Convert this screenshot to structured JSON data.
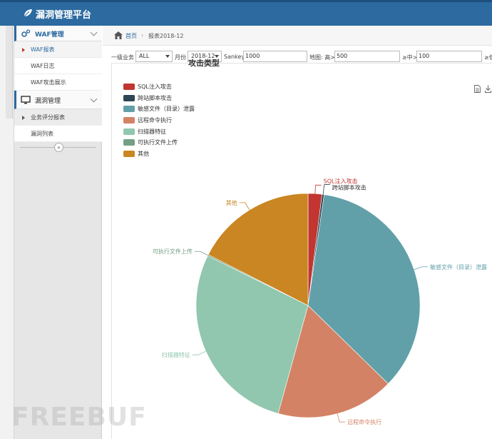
{
  "app": {
    "title": "漏洞管理平台"
  },
  "sidebar": {
    "groups": [
      {
        "label": "WAF管理",
        "icon": "gears-icon",
        "items": [
          {
            "label": "WAF报表"
          },
          {
            "label": "WAF日志"
          },
          {
            "label": "WAF攻击展示"
          }
        ]
      },
      {
        "label": "漏洞管理",
        "icon": "monitor-icon",
        "items": [
          {
            "label": "业务评分报表"
          },
          {
            "label": "漏洞列表"
          }
        ]
      }
    ],
    "collapse_glyph": "«"
  },
  "breadcrumb": {
    "home": "首页",
    "separator": "›",
    "current": "报表2018-12"
  },
  "filters": {
    "business_label": "一级业务",
    "business_value": "ALL",
    "month_label": "月份",
    "month_value": "2018-12",
    "sankey_label": "Sankey",
    "sankey_value": "1000",
    "map_label": "地图: 高>",
    "map_value": "500",
    "mid_label": "≥中>",
    "mid_value": "100",
    "low_label": "≥低"
  },
  "chart_data": {
    "type": "pie",
    "title": "攻击类型",
    "legend_position": "top-left",
    "categories": [
      "SQL注入攻击",
      "跨站脚本攻击",
      "敏感文件（目录）泄露",
      "远程命令执行",
      "扫描器特征",
      "可执行文件上传",
      "其他"
    ],
    "values": [
      2,
      0.3,
      35,
      17,
      28,
      0.2,
      17.5
    ],
    "colors": [
      "#c23531",
      "#2f4554",
      "#61a0a8",
      "#d48265",
      "#91c7ae",
      "#749f83",
      "#ca8622"
    ]
  },
  "toolbar": {
    "data_view_icon": "document-icon",
    "save_icon": "download-icon"
  },
  "watermark": "FREEBUF"
}
